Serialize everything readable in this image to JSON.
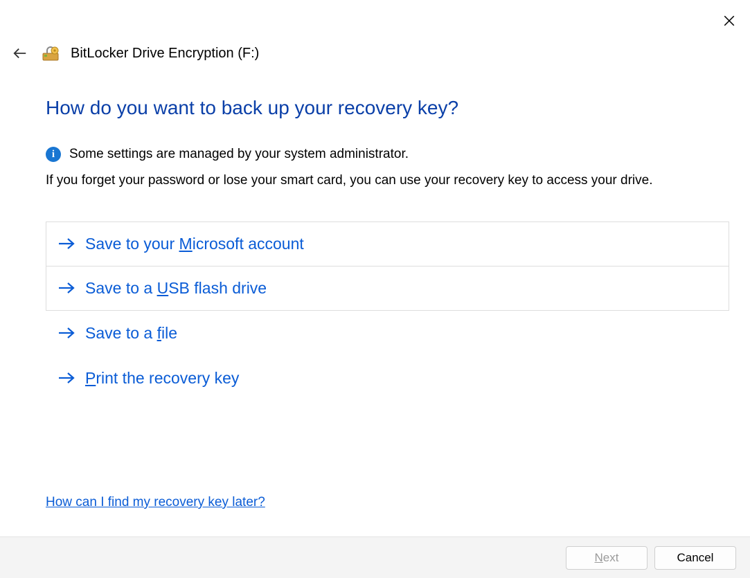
{
  "window": {
    "title": "BitLocker Drive Encryption (F:)"
  },
  "heading": "How do you want to back up your recovery key?",
  "info_text": "Some settings are managed by your system administrator.",
  "description": "If you forget your password or lose your smart card, you can use your recovery key to access your drive.",
  "options": [
    {
      "label": "Save to your Microsoft account",
      "mnemonic": "M",
      "focused": true,
      "bordered": true
    },
    {
      "label": "Save to a USB flash drive",
      "mnemonic": "U",
      "focused": false,
      "bordered": true
    },
    {
      "label": "Save to a file",
      "mnemonic": "f",
      "focused": false,
      "bordered": false
    },
    {
      "label": "Print the recovery key",
      "mnemonic": "P",
      "focused": false,
      "bordered": false
    }
  ],
  "help_link": "How can I find my recovery key later?",
  "buttons": {
    "next": {
      "label": "Next",
      "mnemonic": "N",
      "enabled": false
    },
    "cancel": {
      "label": "Cancel",
      "mnemonic": "",
      "enabled": true
    }
  },
  "colors": {
    "accent": "#0a5cd6",
    "heading": "#0a3fa8"
  }
}
